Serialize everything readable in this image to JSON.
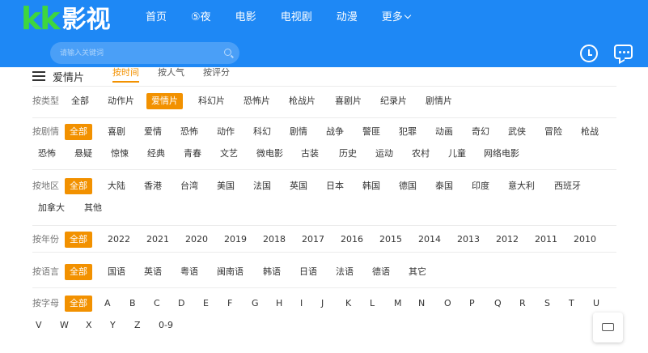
{
  "header": {
    "logo_latin": "kk",
    "logo_cn": "影视",
    "nav": [
      "首页",
      "⑤夜",
      "电影",
      "电视剧",
      "动漫",
      "更多"
    ],
    "search_placeholder": "请输入关键词"
  },
  "title": "爱情片",
  "sort_tabs": [
    "按时间",
    "按人气",
    "按评分"
  ],
  "filters": {
    "type": {
      "label": "按类型",
      "options": [
        "全部",
        "动作片",
        "爱情片",
        "科幻片",
        "恐怖片",
        "枪战片",
        "喜剧片",
        "纪录片",
        "剧情片"
      ]
    },
    "plot": {
      "label": "按剧情",
      "options": [
        "全部",
        "喜剧",
        "爱情",
        "恐怖",
        "动作",
        "科幻",
        "剧情",
        "战争",
        "警匪",
        "犯罪",
        "动画",
        "奇幻",
        "武侠",
        "冒险",
        "枪战",
        "恐怖",
        "悬疑",
        "惊悚",
        "经典",
        "青春",
        "文艺",
        "微电影",
        "古装",
        "历史",
        "运动",
        "农村",
        "儿童",
        "网络电影"
      ]
    },
    "region": {
      "label": "按地区",
      "options": [
        "全部",
        "大陆",
        "香港",
        "台湾",
        "美国",
        "法国",
        "英国",
        "日本",
        "韩国",
        "德国",
        "泰国",
        "印度",
        "意大利",
        "西班牙",
        "加拿大",
        "其他"
      ]
    },
    "year": {
      "label": "按年份",
      "options": [
        "全部",
        "2022",
        "2021",
        "2020",
        "2019",
        "2018",
        "2017",
        "2016",
        "2015",
        "2014",
        "2013",
        "2012",
        "2011",
        "2010"
      ]
    },
    "language": {
      "label": "按语言",
      "options": [
        "全部",
        "国语",
        "英语",
        "粤语",
        "闽南语",
        "韩语",
        "日语",
        "法语",
        "德语",
        "其它"
      ]
    },
    "letter": {
      "label": "按字母",
      "options": [
        "全部",
        "A",
        "B",
        "C",
        "D",
        "E",
        "F",
        "G",
        "H",
        "I",
        "J",
        "K",
        "L",
        "M",
        "N",
        "O",
        "P",
        "Q",
        "R",
        "S",
        "T",
        "U",
        "V",
        "W",
        "X",
        "Y",
        "Z",
        "0-9"
      ]
    }
  },
  "colors": {
    "header_bg": "#1e88f5",
    "accent": "#f29100",
    "logo_green": "#3ed63e"
  },
  "icons": [
    "list-icon",
    "search-icon",
    "clock-icon",
    "message-icon"
  ]
}
